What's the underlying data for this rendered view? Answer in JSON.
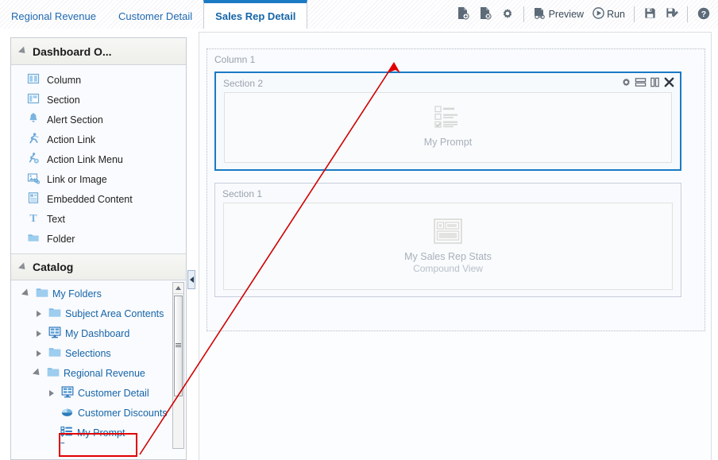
{
  "tabs": [
    {
      "label": "Regional Revenue",
      "active": false
    },
    {
      "label": "Customer Detail",
      "active": false
    },
    {
      "label": "Sales Rep Detail",
      "active": true
    }
  ],
  "toolbar": {
    "add_page": {
      "name": "add-page-icon",
      "tooltip": "Add Dashboard Page"
    },
    "delete_page": {
      "name": "delete-page-icon",
      "tooltip": "Delete Dashboard Page"
    },
    "page_properties": {
      "name": "gear-icon",
      "tooltip": "Tools"
    },
    "preview_label": "Preview",
    "run_label": "Run",
    "save": {
      "name": "save-icon",
      "tooltip": "Save"
    },
    "save_as": {
      "name": "save-as-icon",
      "tooltip": "Save As"
    },
    "help": {
      "name": "help-icon",
      "tooltip": "Help"
    }
  },
  "left_panel": {
    "dashboard_objects": {
      "title": "Dashboard O...",
      "items": [
        {
          "label": "Column",
          "icon": "column-icon"
        },
        {
          "label": "Section",
          "icon": "section-icon"
        },
        {
          "label": "Alert Section",
          "icon": "alert-bell-icon"
        },
        {
          "label": "Action Link",
          "icon": "action-link-icon"
        },
        {
          "label": "Action Link Menu",
          "icon": "action-link-menu-icon"
        },
        {
          "label": "Link or Image",
          "icon": "link-image-icon"
        },
        {
          "label": "Embedded Content",
          "icon": "embedded-content-icon"
        },
        {
          "label": "Text",
          "icon": "text-icon"
        },
        {
          "label": "Folder",
          "icon": "folder-icon"
        }
      ]
    },
    "catalog": {
      "title": "Catalog",
      "tree": [
        {
          "label": "My Folders",
          "icon": "folder-icon",
          "indent": 0,
          "state": "expanded"
        },
        {
          "label": "Subject Area Contents",
          "icon": "folder-icon",
          "indent": 1,
          "state": "collapsed"
        },
        {
          "label": "My Dashboard",
          "icon": "dashboard-icon",
          "indent": 1,
          "state": "collapsed"
        },
        {
          "label": "Selections",
          "icon": "folder-icon",
          "indent": 1,
          "state": "collapsed"
        },
        {
          "label": "Regional Revenue",
          "icon": "folder-icon",
          "indent": 1,
          "state": "expanded"
        },
        {
          "label": "Customer Detail",
          "icon": "dashboard-icon",
          "indent": 2,
          "state": "collapsed"
        },
        {
          "label": "Customer Discounts",
          "icon": "pie-chart-icon",
          "indent": 2,
          "state": "leaf"
        },
        {
          "label": "My Prompt",
          "icon": "prompt-icon",
          "indent": 2,
          "state": "leaf",
          "highlighted": true
        }
      ]
    }
  },
  "canvas": {
    "column_title": "Column 1",
    "sections": [
      {
        "title": "Section 2",
        "selected": true,
        "placeholder_name": "My Prompt",
        "placeholder_sub": "",
        "placeholder_icon": "prompt-placeholder-icon",
        "icons": [
          {
            "name": "gear-icon",
            "tooltip": "Properties"
          },
          {
            "name": "horizontal-layout-icon",
            "tooltip": "Arrange Horizontally"
          },
          {
            "name": "vertical-layout-icon",
            "tooltip": "Arrange Vertically"
          },
          {
            "name": "close-icon",
            "tooltip": "Delete"
          }
        ]
      },
      {
        "title": "Section 1",
        "selected": false,
        "placeholder_name": "My Sales Rep Stats",
        "placeholder_sub": "Compound View",
        "placeholder_icon": "compound-view-icon",
        "icons": []
      }
    ]
  },
  "colors": {
    "accent": "#1a7ac4",
    "link": "#1565a8",
    "annotation": "#e00000",
    "panel_border": "#c6ccd6"
  }
}
